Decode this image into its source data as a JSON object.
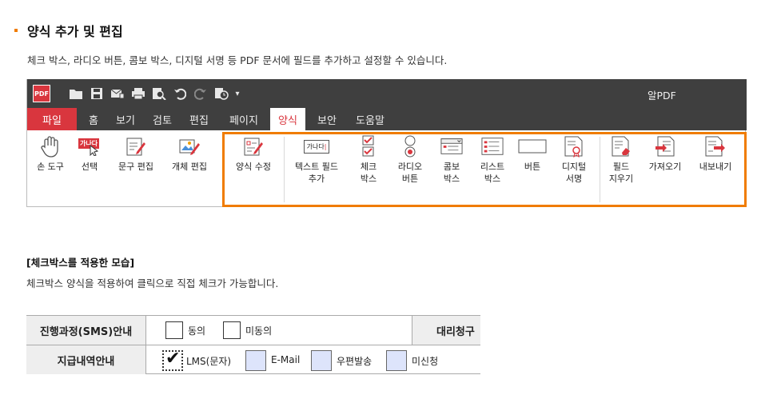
{
  "section": {
    "title": "양식 추가 및 편집",
    "description": "체크 박스, 라디오 버튼, 콤보 박스, 디지털 서명 등 PDF 문서에 필드를 추가하고 설정할 수 있습니다."
  },
  "app": {
    "logo_text": "PDF",
    "title": "알PDF",
    "quick_access_icons": [
      "folder-open-icon",
      "save-icon",
      "email-icon",
      "print-icon",
      "preview-icon",
      "undo-icon",
      "redo-icon",
      "history-icon",
      "dropdown-icon"
    ],
    "tabs": [
      {
        "label": "파일"
      },
      {
        "label": "홈"
      },
      {
        "label": "보기"
      },
      {
        "label": "검토"
      },
      {
        "label": "편집"
      },
      {
        "label": "페이지"
      },
      {
        "label": "양식"
      },
      {
        "label": "보안"
      },
      {
        "label": "도움말"
      }
    ],
    "active_tab": "양식",
    "ribbon": [
      {
        "line1": "손 도구",
        "line2": ""
      },
      {
        "line1": "선택",
        "line2": "",
        "icon_text": "가나다"
      },
      {
        "line1": "문구 편집",
        "line2": ""
      },
      {
        "line1": "개체 편집",
        "line2": ""
      },
      {
        "line1": "양식 수정",
        "line2": ""
      },
      {
        "line1": "텍스트 필드",
        "line2": "추가",
        "icon_text": "가나다"
      },
      {
        "line1": "체크",
        "line2": "박스"
      },
      {
        "line1": "라디오",
        "line2": "버튼"
      },
      {
        "line1": "콤보",
        "line2": "박스"
      },
      {
        "line1": "리스트",
        "line2": "박스"
      },
      {
        "line1": "버튼",
        "line2": ""
      },
      {
        "line1": "디지털",
        "line2": "서명"
      },
      {
        "line1": "필드",
        "line2": "지우기"
      },
      {
        "line1": "가져오기",
        "line2": ""
      },
      {
        "line1": "내보내기",
        "line2": ""
      }
    ],
    "colors": {
      "accent": "#d9363e",
      "highlight": "#f07c00",
      "titlebar": "#3f3f3f"
    }
  },
  "example": {
    "title": "[체크박스를 적용한 모습]",
    "description": "체크박스 양식을 적용하여 클릭으로 직접 체크가 가능합니다.",
    "rows": [
      {
        "label": "진행과정(SMS)안내",
        "options": [
          {
            "label": "동의",
            "checked": false
          },
          {
            "label": "미동의",
            "checked": false
          }
        ],
        "right_label": "대리청구"
      },
      {
        "label": "지급내역안내",
        "options": [
          {
            "label": "LMS(문자)",
            "checked": true,
            "check_mark": "✔"
          },
          {
            "label": "E-Mail",
            "checked": false
          },
          {
            "label": "우편발송",
            "checked": false
          },
          {
            "label": "미신청",
            "checked": false
          }
        ]
      }
    ]
  }
}
